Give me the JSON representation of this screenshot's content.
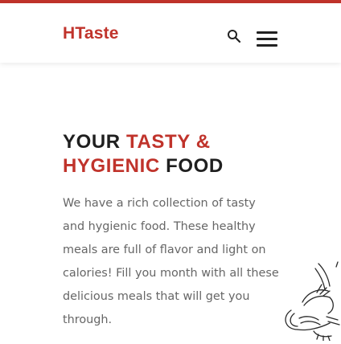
{
  "brand": {
    "name": "HTaste",
    "accent_color": "#c0332b"
  },
  "header": {
    "search_icon": "search-icon",
    "menu_icon": "hamburger-menu-icon"
  },
  "hero": {
    "headline_part1": "YOUR ",
    "headline_part2": "TASTY &",
    "headline_part3": "HYGIENIC",
    "headline_part4": " FOOD",
    "description": "We have a rich collection of tasty and hygienic food. These healthy meals are full of flavor and light on calories! Fill you month with all these delicious meals that will get you through."
  },
  "decoration": {
    "icon": "food-line-art-icon"
  }
}
